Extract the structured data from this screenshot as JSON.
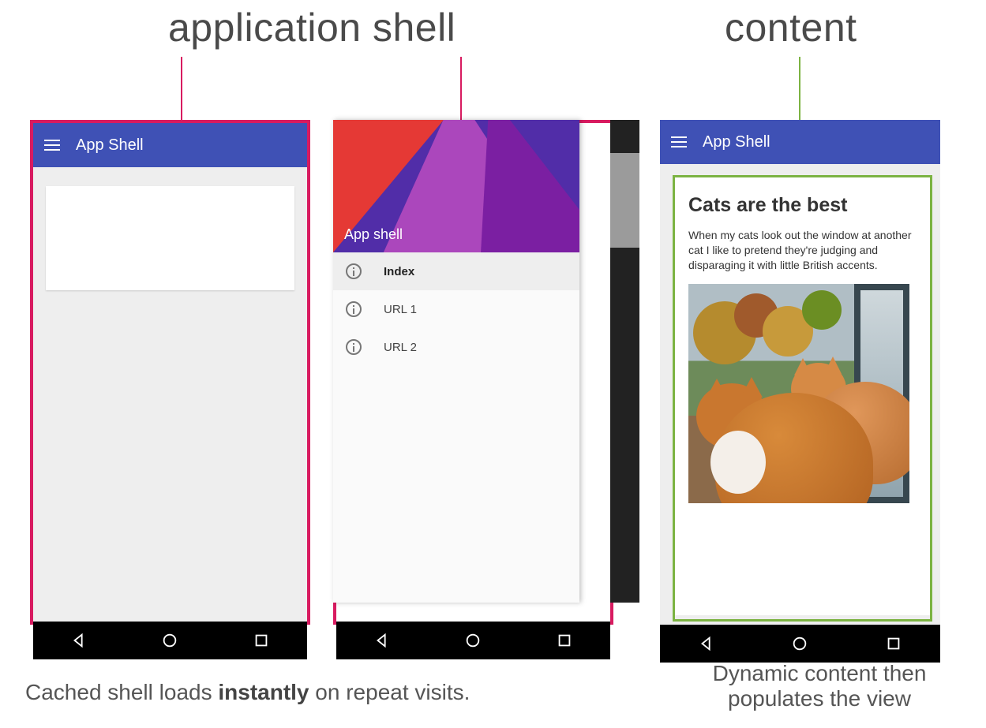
{
  "labels": {
    "shell": "application shell",
    "content": "content"
  },
  "captions": {
    "left_pre": "Cached shell loads ",
    "left_bold": "instantly",
    "left_post": " on repeat visits.",
    "right": "Dynamic content then populates the view"
  },
  "appbar": {
    "title": "App Shell"
  },
  "drawer": {
    "header_title": "App shell",
    "items": [
      {
        "label": "Index",
        "active": true
      },
      {
        "label": "URL 1",
        "active": false
      },
      {
        "label": "URL 2",
        "active": false
      }
    ]
  },
  "content_card": {
    "heading": "Cats are the best",
    "body": "When my cats look out the window at another cat I like to pretend they're judging and disparaging it with little British accents.",
    "image_alt": "Two orange-and-white cats looking out a window at autumn trees"
  },
  "colors": {
    "shell_outline": "#d81b60",
    "content_outline": "#7cb342",
    "appbar": "#3f51b5"
  }
}
